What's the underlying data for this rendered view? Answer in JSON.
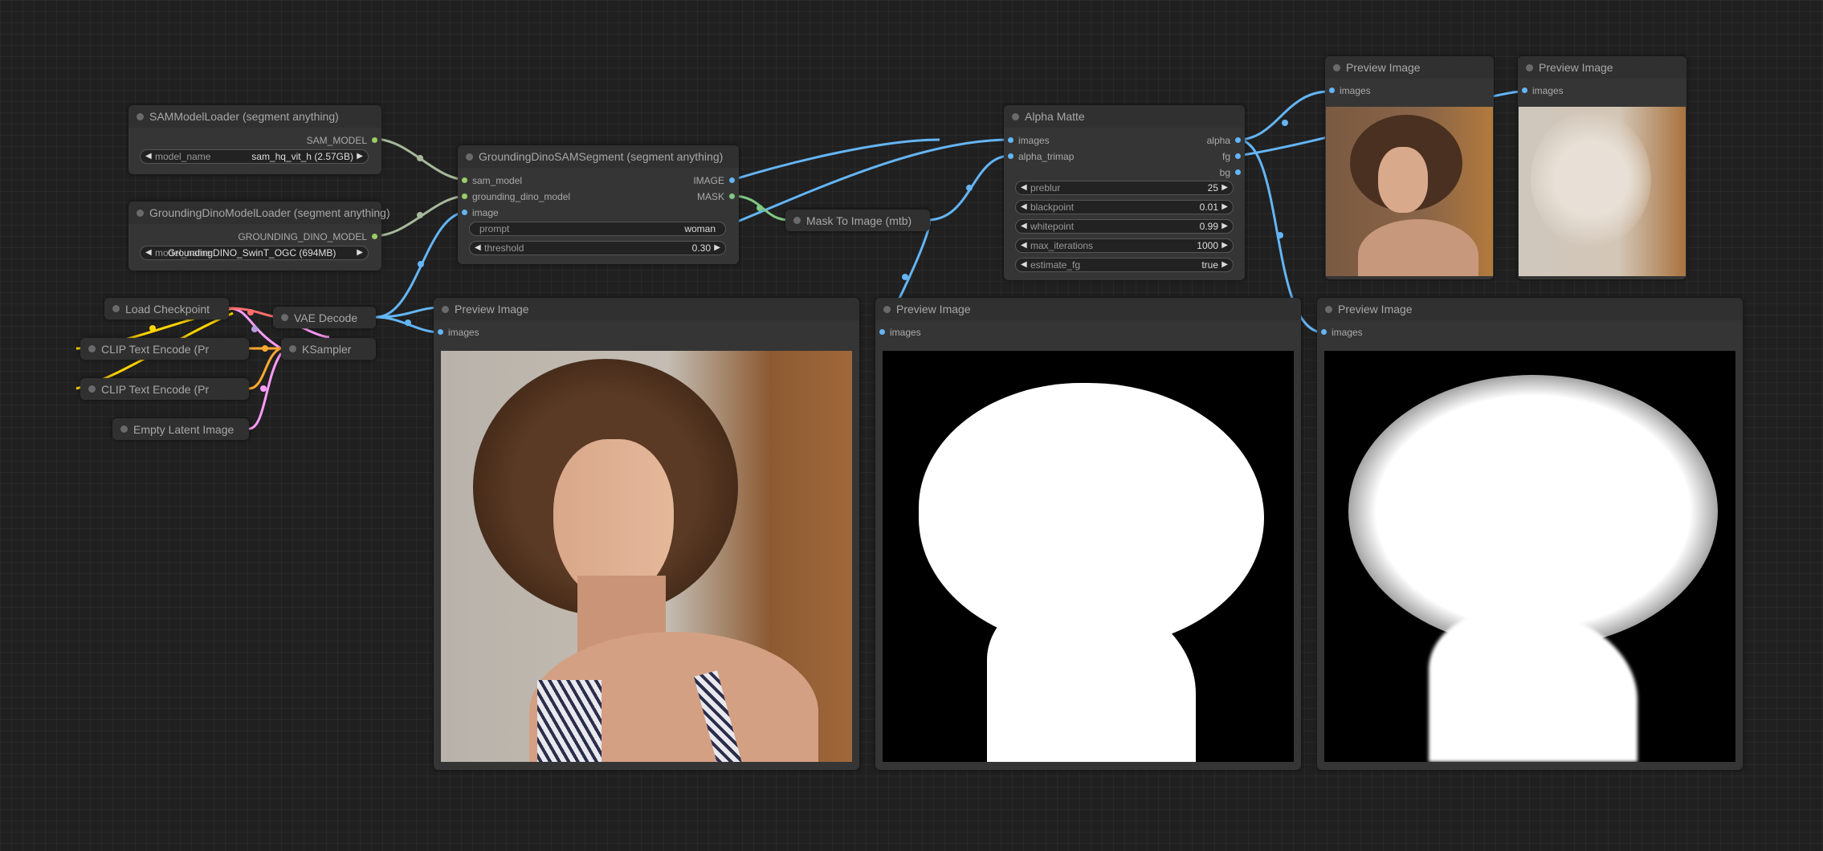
{
  "colors": {
    "image": "#64b5f6",
    "mask": "#81c784",
    "model": "#9ccc65",
    "clip": "#ffd500",
    "latent": "#ff9cf9",
    "vae": "#ff6e6e",
    "conditioning": "#ffa931"
  },
  "sam_loader": {
    "title": "SAMModelLoader (segment anything)",
    "out_sam_model": "SAM_MODEL",
    "w_model_name_label": "model_name",
    "w_model_name_value": "sam_hq_vit_h (2.57GB)"
  },
  "dino_loader": {
    "title": "GroundingDinoModelLoader (segment anything)",
    "out_grounding_dino_model": "GROUNDING_DINO_MODEL",
    "w_model_name_label": "model_name",
    "w_model_name_value": "GroundingDINO_SwinT_OGC (694MB)"
  },
  "dino_sam_segment": {
    "title": "GroundingDinoSAMSegment (segment anything)",
    "in_sam_model": "sam_model",
    "in_grounding_dino_model": "grounding_dino_model",
    "in_image": "image",
    "out_image": "IMAGE",
    "out_mask": "MASK",
    "w_prompt_label": "prompt",
    "w_prompt_value": "woman",
    "w_threshold_label": "threshold",
    "w_threshold_value": "0.30"
  },
  "alpha_matte": {
    "title": "Alpha Matte",
    "in_images": "images",
    "in_alpha_trimap": "alpha_trimap",
    "out_alpha": "alpha",
    "out_fg": "fg",
    "out_bg": "bg",
    "widgets": [
      {
        "label": "preblur",
        "value": "25"
      },
      {
        "label": "blackpoint",
        "value": "0.01"
      },
      {
        "label": "whitepoint",
        "value": "0.99"
      },
      {
        "label": "max_iterations",
        "value": "1000"
      },
      {
        "label": "estimate_fg",
        "value": "true"
      }
    ]
  },
  "mask_to_image": {
    "title": "Mask To Image (mtb)"
  },
  "collapsed": {
    "load_checkpoint": "Load Checkpoint",
    "clip_text_1": "CLIP Text Encode (Pr",
    "clip_text_2": "CLIP Text Encode (Pr",
    "empty_latent": "Empty Latent Image",
    "vae_decode": "VAE Decode",
    "ksampler": "KSampler"
  },
  "preview_small_1": {
    "title": "Preview Image",
    "in_images": "images"
  },
  "preview_small_2": {
    "title": "Preview Image",
    "in_images": "images"
  },
  "preview_large_1": {
    "title": "Preview Image",
    "in_images": "images"
  },
  "preview_large_2": {
    "title": "Preview Image",
    "in_images": "images"
  },
  "preview_large_3": {
    "title": "Preview Image",
    "in_images": "images"
  }
}
